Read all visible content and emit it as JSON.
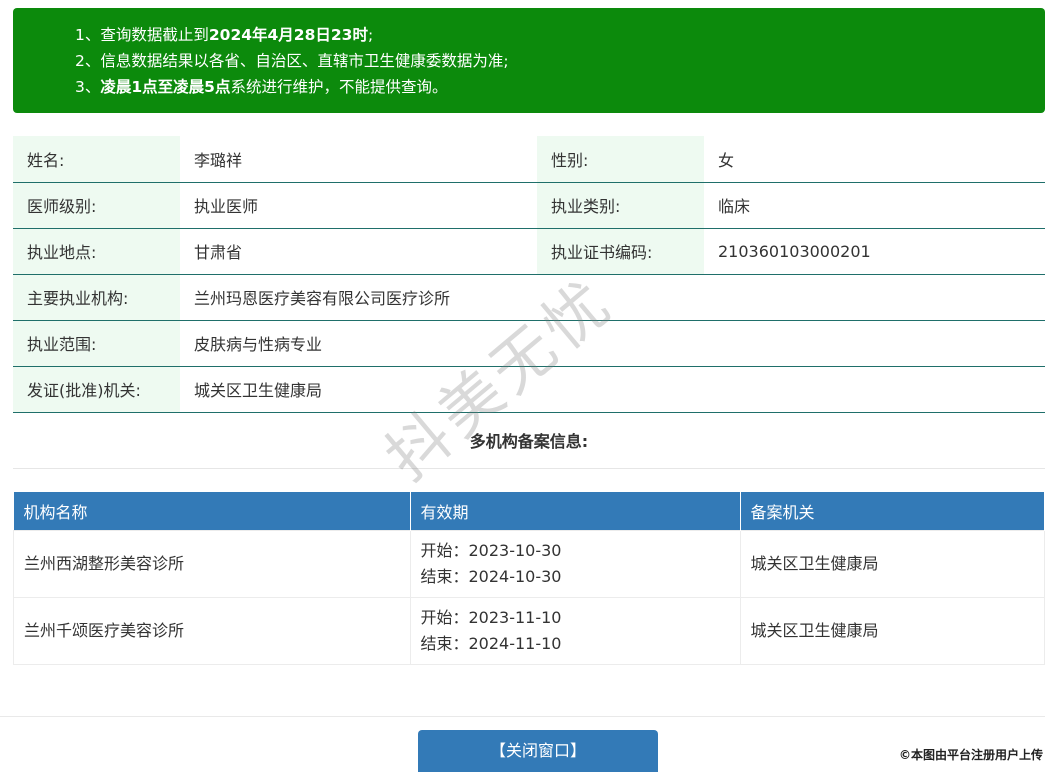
{
  "notice": {
    "line1_prefix": "1、查询数据截止到",
    "line1_bold": "2024年4月28日23时",
    "line1_suffix": ";",
    "line2": "2、信息数据结果以各省、自治区、直辖市卫生健康委数据为准;",
    "line3_prefix": "3、",
    "line3_bold": "凌晨1点至凌晨5点",
    "line3_suffix": "系统进行维护，不能提供查询。"
  },
  "info": {
    "name_label": "姓名:",
    "name_value": "李璐祥",
    "gender_label": "性别:",
    "gender_value": "女",
    "level_label": "医师级别:",
    "level_value": "执业医师",
    "category_label": "执业类别:",
    "category_value": "临床",
    "location_label": "执业地点:",
    "location_value": "甘肃省",
    "cert_label": "执业证书编码:",
    "cert_value": "210360103000201",
    "org_label": "主要执业机构:",
    "org_value": "兰州玛恩医疗美容有限公司医疗诊所",
    "scope_label": "执业范围:",
    "scope_value": "皮肤病与性病专业",
    "issuer_label": "发证(批准)机关:",
    "issuer_value": "城关区卫生健康局"
  },
  "multi": {
    "title": "多机构备案信息:",
    "headers": [
      "机构名称",
      "有效期",
      "备案机关"
    ],
    "rows": [
      {
        "name": "兰州西湖整形美容诊所",
        "start": "开始：2023-10-30",
        "end": "结束：2024-10-30",
        "authority": "城关区卫生健康局"
      },
      {
        "name": "兰州千颂医疗美容诊所",
        "start": "开始：2023-11-10",
        "end": "结束：2024-11-10",
        "authority": "城关区卫生健康局"
      }
    ]
  },
  "close_button": "【关闭窗口】",
  "watermark": "抖美无忧",
  "footer_note": "©本图由平台注册用户上传",
  "colors": {
    "notice_bg": "#0c8a0c",
    "header_blue": "#337ab7",
    "label_bg": "#eefaf1",
    "row_border": "#1f6f6a"
  }
}
